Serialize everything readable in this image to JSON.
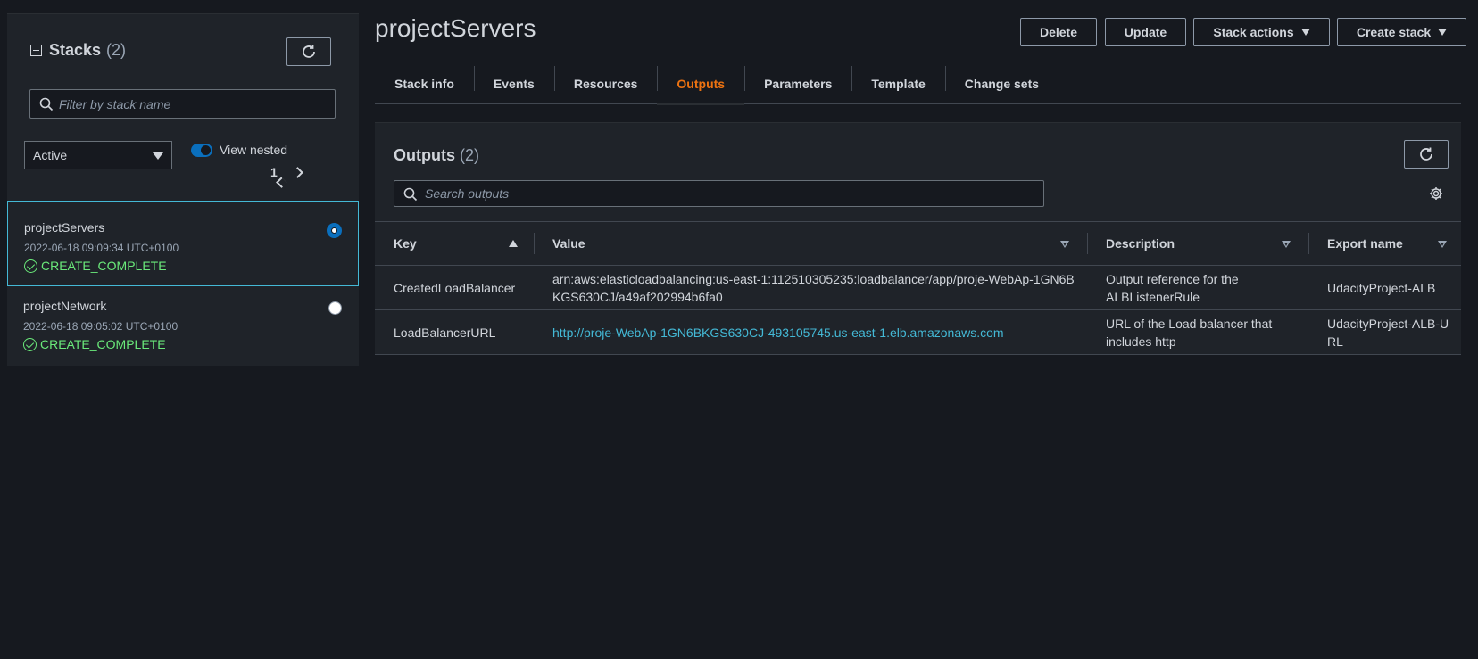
{
  "left": {
    "title": "Stacks",
    "count": "(2)",
    "filter_placeholder": "Filter by stack name",
    "status_filter": "Active",
    "view_nested_label": "View nested",
    "page": "1",
    "stacks": [
      {
        "name": "projectServers",
        "date": "2022-06-18 09:09:34 UTC+0100",
        "status": "CREATE_COMPLETE",
        "selected": true
      },
      {
        "name": "projectNetwork",
        "date": "2022-06-18 09:05:02 UTC+0100",
        "status": "CREATE_COMPLETE",
        "selected": false
      }
    ]
  },
  "header": {
    "title": "projectServers",
    "delete_label": "Delete",
    "update_label": "Update",
    "stack_actions_label": "Stack actions",
    "create_stack_label": "Create stack"
  },
  "tabs": [
    {
      "label": "Stack info",
      "active": false
    },
    {
      "label": "Events",
      "active": false
    },
    {
      "label": "Resources",
      "active": false
    },
    {
      "label": "Outputs",
      "active": true
    },
    {
      "label": "Parameters",
      "active": false
    },
    {
      "label": "Template",
      "active": false
    },
    {
      "label": "Change sets",
      "active": false
    }
  ],
  "outputs": {
    "title": "Outputs",
    "count": "(2)",
    "search_placeholder": "Search outputs",
    "columns": [
      "Key",
      "Value",
      "Description",
      "Export name"
    ],
    "rows": [
      {
        "key": "CreatedLoadBalancer",
        "value": "arn:aws:elasticloadbalancing:us-east-1:112510305235:loadbalancer/app/proje-WebAp-1GN6BKGS630CJ/a49af202994b6fa0",
        "value_is_link": false,
        "description": "Output reference for the ALBListenerRule",
        "export_name": "UdacityProject-ALB"
      },
      {
        "key": "LoadBalancerURL",
        "value": "http://proje-WebAp-1GN6BKGS630CJ-493105745.us-east-1.elb.amazonaws.com",
        "value_is_link": true,
        "description": "URL of the Load balancer that includes http",
        "export_name": "UdacityProject-ALB-URL"
      }
    ]
  },
  "colors": {
    "background": "#16191f",
    "panel": "#1f2329",
    "accent_orange": "#ec7211",
    "link_blue": "#44b9d6",
    "success_green": "#6ae97a",
    "toggle_blue": "#0a6fbd"
  },
  "icons": [
    "collapse-icon",
    "refresh-icon",
    "search-icon",
    "caret-down-icon",
    "chevron-left-icon",
    "chevron-right-icon",
    "check-circle-icon",
    "gear-icon",
    "sort-asc-icon",
    "sort-desc-icon"
  ]
}
